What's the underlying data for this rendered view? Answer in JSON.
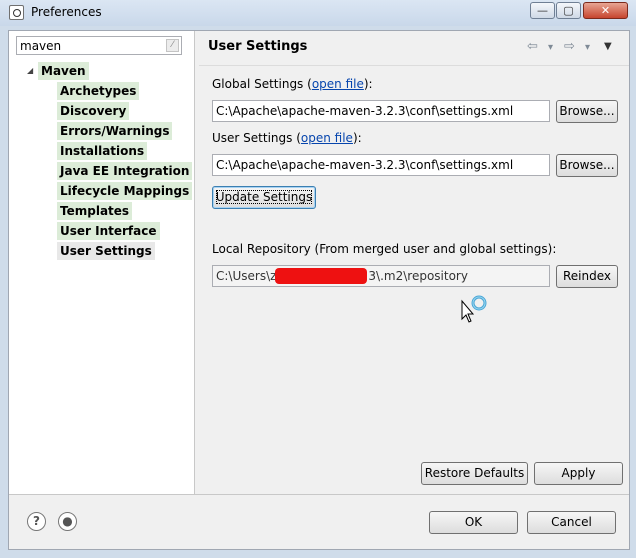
{
  "window": {
    "title": "Preferences",
    "controls": {
      "minimize": "—",
      "maximize": "▢",
      "close": "✕"
    }
  },
  "filter": {
    "value": "maven",
    "clear_icon": "clear-icon"
  },
  "tree": {
    "root": "Maven",
    "children": [
      "Archetypes",
      "Discovery",
      "Errors/Warnings",
      "Installations",
      "Java EE Integration",
      "Lifecycle Mappings",
      "Templates",
      "User Interface",
      "User Settings"
    ],
    "selected": "User Settings",
    "highlight_color": "#dcecd8"
  },
  "page": {
    "title": "User Settings",
    "nav": {
      "back": "⇦",
      "forward": "⇨",
      "menu": "▼",
      "dropdown": "▾"
    },
    "global_settings": {
      "label_prefix": "Global Settings (",
      "link": "open file",
      "label_suffix": "):",
      "value": "C:\\Apache\\apache-maven-3.2.3\\conf\\settings.xml",
      "browse": "Browse..."
    },
    "user_settings": {
      "label_prefix": "User Settings (",
      "link": "open file",
      "label_suffix": "):",
      "value": "C:\\Apache\\apache-maven-3.2.3\\conf\\settings.xml",
      "browse": "Browse..."
    },
    "update_button": "Update Settings",
    "local_repo": {
      "label": "Local Repository (From merged user and global settings):",
      "value_prefix": "C:\\Users\\z",
      "value_suffix": "3\\.m2\\repository",
      "reindex": "Reindex"
    },
    "restore_defaults": "Restore Defaults",
    "apply": "Apply"
  },
  "footer": {
    "help_icon": "?",
    "ok": "OK",
    "cancel": "Cancel"
  }
}
